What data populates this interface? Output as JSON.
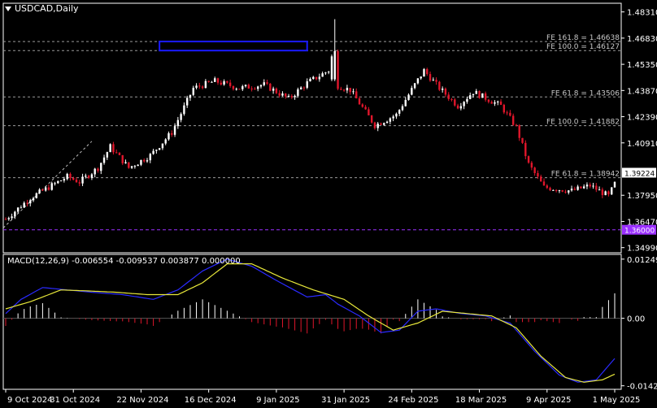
{
  "window": {
    "title": "USDCAD,Daily"
  },
  "colors": {
    "bull": "#ffffff",
    "bear": "#e0162b",
    "grid": "#9a9a9a",
    "macd_main": "#2a2aff",
    "macd_signal": "#e8e83a",
    "hist_pos": "#ffffff",
    "hist_neg": "#e0162b",
    "support": "#9b30ff",
    "zone": "#1a1aff",
    "ask_label": "#ffffff"
  },
  "chart_data": [
    {
      "type": "candlestick",
      "title": "USDCAD,Daily",
      "x_ticks": [
        "9 Oct 2024",
        "31 Oct 2024",
        "22 Nov 2024",
        "16 Dec 2024",
        "9 Jan 2025",
        "31 Jan 2025",
        "24 Feb 2025",
        "18 Mar 2025",
        "9 Apr 2025",
        "1 May 2025"
      ],
      "y_ticks": [
        "1.48310",
        "1.46830",
        "1.45350",
        "1.43870",
        "1.42390",
        "1.40910",
        "1.39224",
        "1.37950",
        "1.36470",
        "1.34990"
      ],
      "ylim": [
        1.347,
        1.488
      ],
      "current_price_label": "1.39224",
      "support_label": "1.36000",
      "levels": [
        {
          "label": "FE 161.8 = 1.46638",
          "value": 1.46638
        },
        {
          "label": "FE 100.0 = 1.46127",
          "value": 1.46127
        },
        {
          "label": "FE 61.8 = 1.43506",
          "value": 1.43506
        },
        {
          "label": "FE 100.0 = 1.41882",
          "value": 1.41882
        },
        {
          "label": "FE 61.8 = 1.38942",
          "value": 1.38942
        }
      ],
      "support_level": 1.36,
      "anchors": [
        [
          0,
          1.366
        ],
        [
          8,
          1.378
        ],
        [
          20,
          1.39
        ],
        [
          24,
          1.387
        ],
        [
          30,
          1.395
        ],
        [
          34,
          1.407
        ],
        [
          40,
          1.395
        ],
        [
          47,
          1.402
        ],
        [
          54,
          1.415
        ],
        [
          61,
          1.44
        ],
        [
          68,
          1.444
        ],
        [
          76,
          1.44
        ],
        [
          84,
          1.442
        ],
        [
          92,
          1.434
        ],
        [
          98,
          1.443
        ],
        [
          105,
          1.45
        ],
        [
          107,
          1.442
        ],
        [
          112,
          1.439
        ],
        [
          120,
          1.419
        ],
        [
          127,
          1.425
        ],
        [
          133,
          1.442
        ],
        [
          136,
          1.45
        ],
        [
          141,
          1.44
        ],
        [
          147,
          1.43
        ],
        [
          152,
          1.438
        ],
        [
          161,
          1.43
        ],
        [
          166,
          1.418
        ],
        [
          170,
          1.397
        ],
        [
          175,
          1.384
        ],
        [
          184,
          1.382
        ],
        [
          190,
          1.385
        ],
        [
          196,
          1.379
        ],
        [
          198,
          1.386
        ]
      ],
      "spikes": [
        [
          107,
          1.479,
          1.444,
          1.461
        ],
        [
          106,
          1.459,
          1.444,
          1.458
        ]
      ]
    },
    {
      "type": "line",
      "title": "MACD(12,26,9) -0.006554 -0.009537 0.003877 0.000000",
      "y_ticks": [
        "0.012498",
        "0.00",
        "-0.014259"
      ],
      "ylim": [
        -0.015,
        0.0135
      ],
      "series": [
        {
          "name": "main",
          "anchors": [
            [
              0,
              0.001
            ],
            [
              5,
              0.004
            ],
            [
              12,
              0.0065
            ],
            [
              20,
              0.006
            ],
            [
              28,
              0.0055
            ],
            [
              38,
              0.005
            ],
            [
              48,
              0.004
            ],
            [
              56,
              0.006
            ],
            [
              64,
              0.01
            ],
            [
              72,
              0.0125
            ],
            [
              80,
              0.011
            ],
            [
              88,
              0.008
            ],
            [
              98,
              0.0045
            ],
            [
              104,
              0.005
            ],
            [
              108,
              0.003
            ],
            [
              115,
              0.0005
            ],
            [
              122,
              -0.003
            ],
            [
              128,
              -0.0025
            ],
            [
              134,
              0.0015
            ],
            [
              140,
              0.002
            ],
            [
              148,
              0.001
            ],
            [
              156,
              0.0005
            ],
            [
              164,
              -0.001
            ],
            [
              172,
              -0.007
            ],
            [
              180,
              -0.012
            ],
            [
              186,
              -0.0135
            ],
            [
              192,
              -0.013
            ],
            [
              198,
              -0.0085
            ]
          ]
        },
        {
          "name": "signal",
          "anchors": [
            [
              0,
              0.002
            ],
            [
              8,
              0.0035
            ],
            [
              18,
              0.006
            ],
            [
              26,
              0.0058
            ],
            [
              36,
              0.0055
            ],
            [
              46,
              0.005
            ],
            [
              56,
              0.005
            ],
            [
              64,
              0.0075
            ],
            [
              72,
              0.0115
            ],
            [
              80,
              0.0115
            ],
            [
              90,
              0.0085
            ],
            [
              100,
              0.006
            ],
            [
              110,
              0.004
            ],
            [
              118,
              0.0005
            ],
            [
              126,
              -0.0025
            ],
            [
              134,
              -0.001
            ],
            [
              142,
              0.0015
            ],
            [
              150,
              0.001
            ],
            [
              158,
              0.0005
            ],
            [
              166,
              -0.002
            ],
            [
              174,
              -0.008
            ],
            [
              182,
              -0.0125
            ],
            [
              188,
              -0.0135
            ],
            [
              194,
              -0.013
            ],
            [
              198,
              -0.0118
            ]
          ]
        }
      ],
      "histogram_note": "difference of main and signal"
    }
  ],
  "macd_label": "MACD(12,26,9) -0.006554 -0.009537 0.003877 0.000000"
}
